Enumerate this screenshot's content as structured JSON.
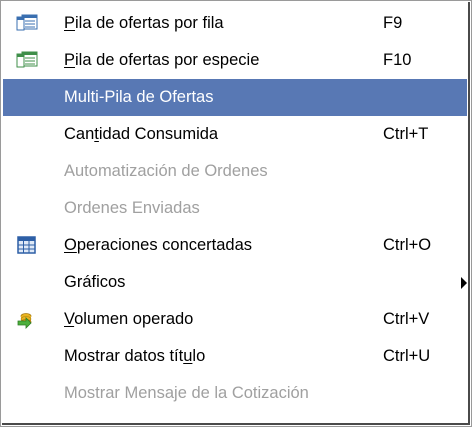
{
  "menu": {
    "items": [
      {
        "pre": "",
        "mn": "P",
        "post": "ila de ofertas por fila",
        "shortcut": "F9",
        "icon": "table-window-icon"
      },
      {
        "pre": "",
        "mn": "P",
        "post": "ila de ofertas por especie",
        "shortcut": "F10",
        "icon": "table-window-green-icon"
      },
      {
        "pre": "Multi-Pila de Ofertas",
        "mn": "",
        "post": "",
        "shortcut": ""
      },
      {
        "pre": "Can",
        "mn": "t",
        "post": "idad Consumida",
        "shortcut": "Ctrl+T"
      },
      {
        "pre": "Automatización de Ordenes",
        "mn": "",
        "post": "",
        "shortcut": ""
      },
      {
        "pre": "Ordenes Enviadas",
        "mn": "",
        "post": "",
        "shortcut": ""
      },
      {
        "pre": "",
        "mn": "O",
        "post": "peraciones concertadas",
        "shortcut": "Ctrl+O",
        "icon": "grid-calendar-icon"
      },
      {
        "pre": "Gráficos",
        "mn": "",
        "post": "",
        "shortcut": "",
        "submenu": "submenu-arrow-icon"
      },
      {
        "pre": "",
        "mn": "V",
        "post": "olumen operado",
        "shortcut": "Ctrl+V",
        "icon": "coins-arrow-icon"
      },
      {
        "pre": "Mostrar datos tít",
        "mn": "u",
        "post": "lo",
        "shortcut": "Ctrl+U"
      },
      {
        "pre": "Mostrar Mensaje de la Cotización",
        "mn": "",
        "post": "",
        "shortcut": ""
      }
    ],
    "highlighted_index": 2,
    "disabled_indices": [
      4,
      5,
      10
    ]
  }
}
